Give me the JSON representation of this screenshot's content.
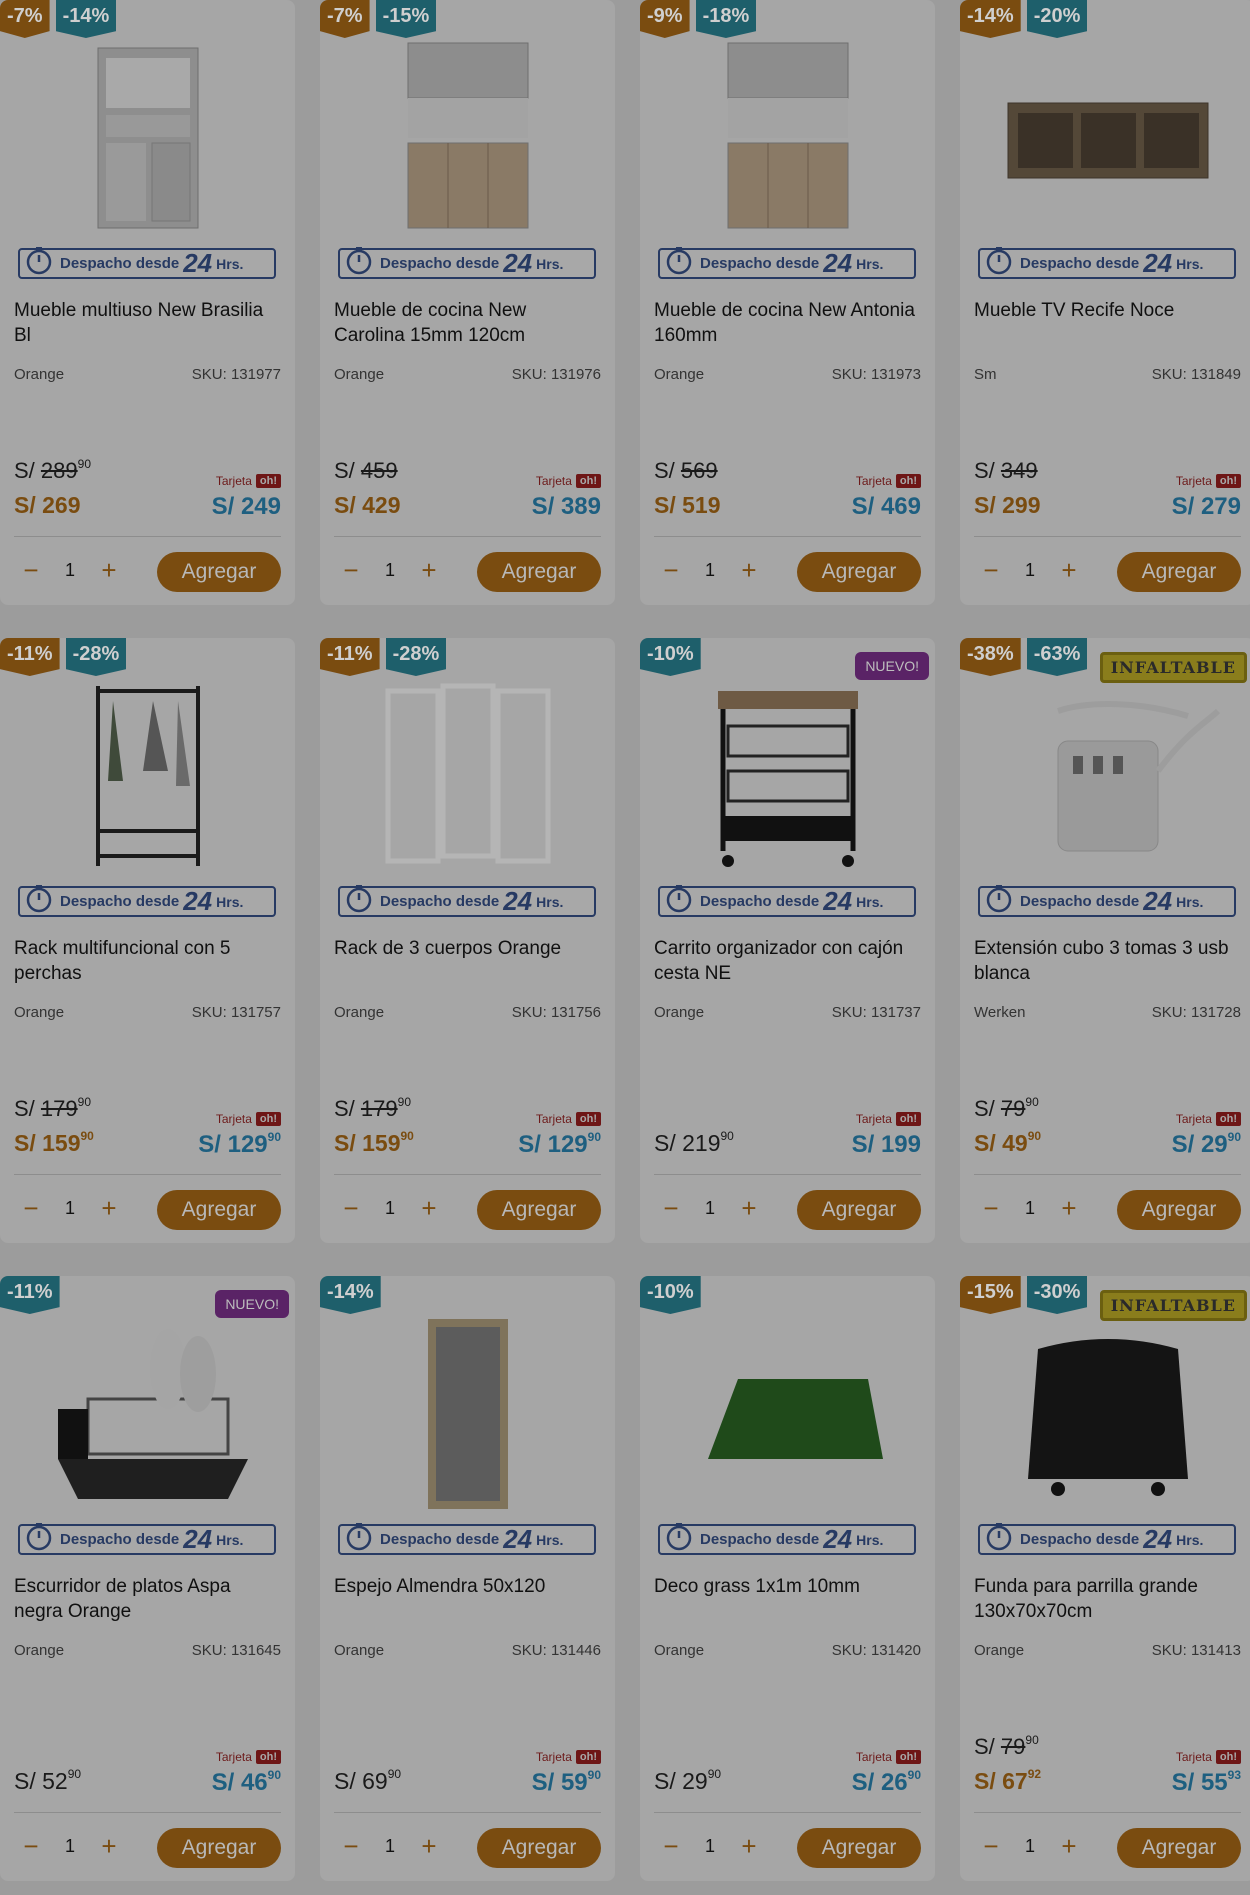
{
  "common": {
    "ship_text": "Despacho desde",
    "ship_num": "24",
    "ship_hrs": "Hrs.",
    "card_label": "Tarjeta",
    "card_brand": "oh!",
    "qty": "1",
    "minus": "−",
    "plus": "+",
    "add_label": "Agregar",
    "currency": "S/"
  },
  "colors": {
    "orange": "#e67e22",
    "blue": "#2aa6c7",
    "purple": "#8e3aa7"
  },
  "products": [
    {
      "badges": [
        {
          "t": "-7%",
          "c": "orange"
        },
        {
          "t": "-14%",
          "c": "blue"
        }
      ],
      "tag": "",
      "name": "Mueble multiuso New Brasilia Bl",
      "brand": "Orange",
      "sku": "SKU: 131977",
      "old": "289",
      "old_dec": "90",
      "cur": "269",
      "cur_dec": "",
      "cur_plain": false,
      "card": "249",
      "card_dec": "",
      "icon": "cabinet-icon"
    },
    {
      "badges": [
        {
          "t": "-7%",
          "c": "orange"
        },
        {
          "t": "-15%",
          "c": "blue"
        }
      ],
      "tag": "",
      "name": "Mueble de cocina New Carolina 15mm 120cm",
      "brand": "Orange",
      "sku": "SKU: 131976",
      "old": "459",
      "old_dec": "",
      "cur": "429",
      "cur_dec": "",
      "cur_plain": false,
      "card": "389",
      "card_dec": "",
      "icon": "kitchen-cabinet-icon"
    },
    {
      "badges": [
        {
          "t": "-9%",
          "c": "orange"
        },
        {
          "t": "-18%",
          "c": "blue"
        }
      ],
      "tag": "",
      "name": "Mueble de cocina New Antonia 160mm",
      "brand": "Orange",
      "sku": "SKU: 131973",
      "old": "569",
      "old_dec": "",
      "cur": "519",
      "cur_dec": "",
      "cur_plain": false,
      "card": "469",
      "card_dec": "",
      "icon": "kitchen-cabinet-icon"
    },
    {
      "badges": [
        {
          "t": "-14%",
          "c": "orange"
        },
        {
          "t": "-20%",
          "c": "blue"
        }
      ],
      "tag": "",
      "name": "Mueble TV Recife Noce",
      "brand": "Sm",
      "sku": "SKU: 131849",
      "old": "349",
      "old_dec": "",
      "cur": "299",
      "cur_dec": "",
      "cur_plain": false,
      "card": "279",
      "card_dec": "",
      "icon": "tv-stand-icon"
    },
    {
      "badges": [
        {
          "t": "-11%",
          "c": "orange"
        },
        {
          "t": "-28%",
          "c": "blue"
        }
      ],
      "tag": "",
      "name": "Rack multifuncional con 5 perchas",
      "brand": "Orange",
      "sku": "SKU: 131757",
      "old": "179",
      "old_dec": "90",
      "cur": "159",
      "cur_dec": "90",
      "cur_plain": false,
      "card": "129",
      "card_dec": "90",
      "icon": "clothes-rack-icon"
    },
    {
      "badges": [
        {
          "t": "-11%",
          "c": "orange"
        },
        {
          "t": "-28%",
          "c": "blue"
        }
      ],
      "tag": "",
      "name": "Rack de 3 cuerpos Orange",
      "brand": "Orange",
      "sku": "SKU: 131756",
      "old": "179",
      "old_dec": "90",
      "cur": "159",
      "cur_dec": "90",
      "cur_plain": false,
      "card": "129",
      "card_dec": "90",
      "icon": "drying-rack-icon"
    },
    {
      "badges": [
        {
          "t": "-10%",
          "c": "blue"
        }
      ],
      "tag": "NUEVO!",
      "name": "Carrito organizador con cajón cesta NE",
      "brand": "Orange",
      "sku": "SKU: 131737",
      "old": "",
      "old_dec": "",
      "cur": "219",
      "cur_dec": "90",
      "cur_plain": true,
      "card": "199",
      "card_dec": "",
      "icon": "cart-organizer-icon"
    },
    {
      "badges": [
        {
          "t": "-38%",
          "c": "orange"
        },
        {
          "t": "-63%",
          "c": "blue"
        }
      ],
      "tag": "INFALTABLE",
      "name": "Extensión cubo 3 tomas 3 usb blanca",
      "brand": "Werken",
      "sku": "SKU: 131728",
      "old": "79",
      "old_dec": "90",
      "cur": "49",
      "cur_dec": "90",
      "cur_plain": false,
      "card": "29",
      "card_dec": "90",
      "icon": "power-cube-icon"
    },
    {
      "badges": [
        {
          "t": "-11%",
          "c": "blue"
        }
      ],
      "tag": "NUEVO!",
      "name": "Escurridor de platos Aspa negra Orange",
      "brand": "Orange",
      "sku": "SKU: 131645",
      "old": "",
      "old_dec": "",
      "cur": "52",
      "cur_dec": "90",
      "cur_plain": true,
      "card": "46",
      "card_dec": "90",
      "icon": "dish-rack-icon"
    },
    {
      "badges": [
        {
          "t": "-14%",
          "c": "blue"
        }
      ],
      "tag": "",
      "name": "Espejo Almendra 50x120",
      "brand": "Orange",
      "sku": "SKU: 131446",
      "old": "",
      "old_dec": "",
      "cur": "69",
      "cur_dec": "90",
      "cur_plain": true,
      "card": "59",
      "card_dec": "90",
      "icon": "mirror-icon"
    },
    {
      "badges": [
        {
          "t": "-10%",
          "c": "blue"
        }
      ],
      "tag": "",
      "name": "Deco grass 1x1m 10mm",
      "brand": "Orange",
      "sku": "SKU: 131420",
      "old": "",
      "old_dec": "",
      "cur": "29",
      "cur_dec": "90",
      "cur_plain": true,
      "card": "26",
      "card_dec": "90",
      "icon": "grass-icon"
    },
    {
      "badges": [
        {
          "t": "-15%",
          "c": "orange"
        },
        {
          "t": "-30%",
          "c": "blue"
        }
      ],
      "tag": "INFALTABLE",
      "name": "Funda para parrilla grande 130x70x70cm",
      "brand": "Orange",
      "sku": "SKU: 131413",
      "old": "79",
      "old_dec": "90",
      "cur": "67",
      "cur_dec": "92",
      "cur_plain": false,
      "card": "55",
      "card_dec": "93",
      "icon": "grill-cover-icon"
    }
  ]
}
